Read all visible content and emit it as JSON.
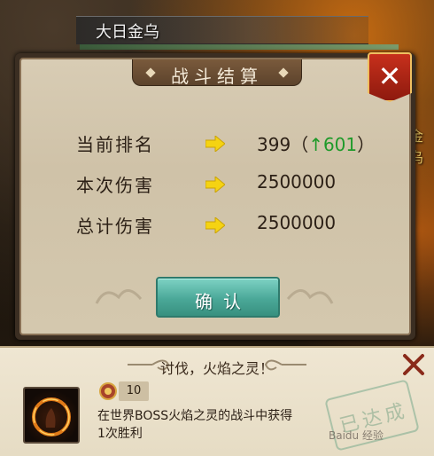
{
  "background": {
    "boss_name": "大日金乌",
    "right_partial_label": "金乌"
  },
  "dialog": {
    "title": "战斗结算",
    "close_label": "✕",
    "stats": [
      {
        "label": "当前排名",
        "value": "399",
        "change_prefix": "（",
        "change": "↑601",
        "change_suffix": "）"
      },
      {
        "label": "本次伤害",
        "value": "2500000"
      },
      {
        "label": "总计伤害",
        "value": "2500000"
      }
    ],
    "confirm_label": "确认"
  },
  "achievement": {
    "title": "讨伐，火焰之灵！",
    "reward_count": "10",
    "description_line1": "在世界BOSS火焰之灵的战斗中获得",
    "description_line2": "1次胜利",
    "stamp_text": "已达成"
  },
  "watermark": "Baidu 经验",
  "colors": {
    "rank_up": "#1f9a2a",
    "confirm_button": "#4aa898",
    "close_button": "#c7301c"
  }
}
